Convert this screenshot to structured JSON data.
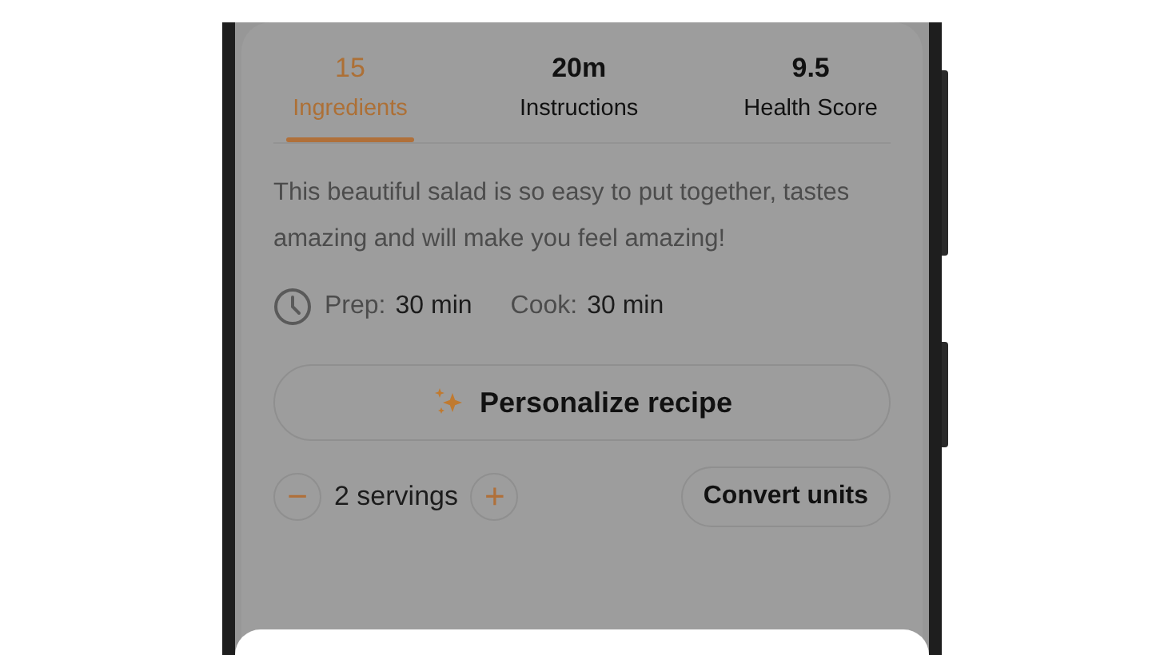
{
  "tabs": [
    {
      "value": "15",
      "label": "Ingredients",
      "selected": true
    },
    {
      "value": "20m",
      "label": "Instructions",
      "selected": false
    },
    {
      "value": "9.5",
      "label": "Health Score",
      "selected": false
    }
  ],
  "description": "This beautiful salad is so easy to put together, tastes amazing and will make you feel amazing!",
  "times": [
    {
      "label": "Prep:",
      "value": "30 min"
    },
    {
      "label": "Cook:",
      "value": "30 min"
    }
  ],
  "personalize_button": "Personalize recipe",
  "servings": {
    "minus": "−",
    "text": "2 servings",
    "plus": "+"
  },
  "convert_button": "Convert units",
  "bottom_sheet": {
    "visible": true
  }
}
